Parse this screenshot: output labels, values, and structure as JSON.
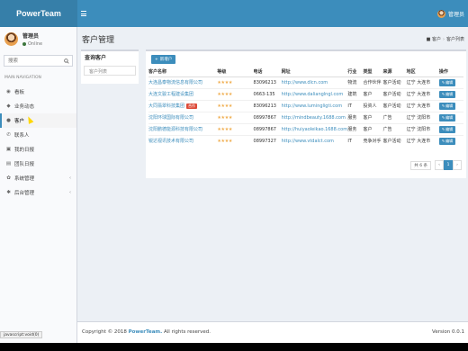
{
  "header": {
    "logo": "PowerTeam",
    "user_name": "管理员"
  },
  "sidebar": {
    "user": {
      "name": "管理员",
      "status": "Online"
    },
    "search_placeholder": "搜索",
    "section_title": "MAIN NAVIGATION",
    "items": [
      {
        "label": "看板",
        "icon": "dashboard-icon"
      },
      {
        "label": "业务动态",
        "icon": "feed-icon"
      },
      {
        "label": "客户",
        "icon": "user-icon",
        "active": true
      },
      {
        "label": "联系人",
        "icon": "contact-icon"
      },
      {
        "label": "我的日报",
        "icon": "calendar-icon"
      },
      {
        "label": "团队日报",
        "icon": "team-icon"
      },
      {
        "label": "系统管理",
        "icon": "gear-icon",
        "has_children": true
      },
      {
        "label": "后台管理",
        "icon": "admin-icon",
        "has_children": true
      }
    ]
  },
  "page": {
    "title": "客户管理",
    "breadcrumb": [
      "客户",
      "客户列表"
    ]
  },
  "query_box": {
    "title": "查询客户",
    "button": "客户列表"
  },
  "customers": {
    "add_button": "新增户",
    "columns": [
      "客户名称",
      "等级",
      "电话",
      "网址",
      "行业",
      "类型",
      "来源",
      "地区",
      "操作"
    ],
    "rows": [
      {
        "name": "大连昌泰物流信息有限公司",
        "stars": "★★★★",
        "phone": "83096213",
        "url": "http://www.dlcn.com",
        "industry": "物流",
        "type": "合作伙伴",
        "source": "客户活动",
        "region": "辽宁 大连市",
        "action": "编辑"
      },
      {
        "name": "大连文骏工程建设集团",
        "stars": "★★★★",
        "phone": "0663-135",
        "url": "http://www.dalianglngl.com",
        "industry": "建筑",
        "type": "客户",
        "source": "客户活动",
        "region": "辽宁 大连市",
        "action": "编辑"
      },
      {
        "name": "大同翡翠科技集团",
        "badge": "合作",
        "stars": "★★★★",
        "phone": "83096213",
        "url": "http://www.lumingligti.com",
        "industry": "IT",
        "type": "投资人",
        "source": "客户活动",
        "region": "辽宁 大连市",
        "action": "编辑"
      },
      {
        "name": "沈阳环球国际有限公司",
        "stars": "★★★★",
        "phone": "08997867",
        "url": "http://mindbeauty.1688.com",
        "industry": "服务",
        "type": "客户",
        "source": "广告",
        "region": "辽宁 沈阳市",
        "action": "编辑"
      },
      {
        "name": "沈阳鹏德能源科技有限公司",
        "stars": "★★★★",
        "phone": "08997867",
        "url": "http://huiyaoleikao.1688.com",
        "industry": "服务",
        "type": "客户",
        "source": "广告",
        "region": "辽宁 沈阳市",
        "action": "编辑"
      },
      {
        "name": "锐达视讯技术有限公司",
        "stars": "★★★★",
        "phone": "08997327",
        "url": "http://www.vtdalct.com",
        "industry": "IT",
        "type": "竞争对手",
        "source": "客户活动",
        "region": "辽宁 大连市",
        "action": "编辑"
      }
    ],
    "pager": {
      "info": "共 6 条",
      "prev": "‹",
      "current": "1",
      "next": "›"
    }
  },
  "footer": {
    "copyright_prefix": "Copyright © 2018",
    "brand": "PowerTeam.",
    "rights": "All rights reserved.",
    "version": "Version 0.0.1"
  },
  "status_url": "javascript:void(0)"
}
